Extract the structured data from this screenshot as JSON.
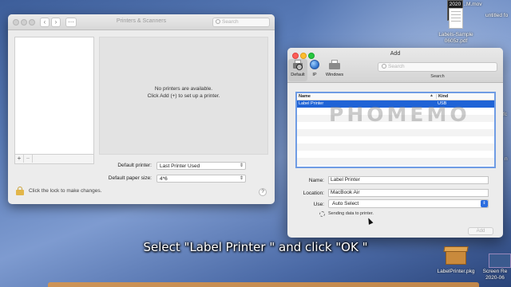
{
  "printers_window": {
    "title": "Printers & Scanners",
    "search_placeholder": "Search",
    "empty_message_line1": "No printers are available.",
    "empty_message_line2": "Click Add (+) to set up a printer.",
    "add_symbol": "+",
    "remove_symbol": "−",
    "default_printer_label": "Default printer:",
    "default_printer_value": "Last Printer Used",
    "paper_size_label": "Default paper size:",
    "paper_size_value": "4*6",
    "lock_text": "Click the lock to make changes.",
    "help_symbol": "?"
  },
  "add_window": {
    "title": "Add",
    "toolbar": [
      {
        "label": "Default",
        "icon": "default-printer-icon",
        "selected": true
      },
      {
        "label": "IP",
        "icon": "globe-icon",
        "selected": false
      },
      {
        "label": "Windows",
        "icon": "windows-printer-icon",
        "selected": false
      }
    ],
    "search_placeholder": "Search",
    "search_label": "Search",
    "table": {
      "columns": [
        "Name",
        "Kind"
      ],
      "sort_indicator": "▲",
      "rows": [
        {
          "name": "Label Printer",
          "kind": "USB",
          "selected": true
        }
      ]
    },
    "watermark": "PHOMEMO",
    "name_label": "Name:",
    "name_value": "Label Printer",
    "location_label": "Location:",
    "location_value": "MacBook Air",
    "use_label": "Use:",
    "use_value": "Auto Select",
    "status_text": "Sending data to printer.",
    "add_button": "Add"
  },
  "subtitle": "Select \"Label Printer \" and click \"OK \"",
  "desktop": {
    "items": [
      {
        "label_line1": "2020",
        "label_line2": "..M.mov"
      },
      {
        "label_line1": "Labels-Sample",
        "label_line2": "0605z.pdf"
      },
      {
        "label_line1": "LabelPrinter.pkg",
        "label_line2": ""
      },
      {
        "label_line1": "Screen Re",
        "label_line2": "2020-06"
      }
    ],
    "edge_text_1": "untitled fo",
    "edge_text_2": "fc",
    "edge_text_3": "n"
  },
  "colors": {
    "selection": "#1f63d6",
    "focus_ring": "#6f9ce4",
    "close": "#fc5d57",
    "minimize": "#fdbc2e",
    "zoom": "#27c840"
  }
}
